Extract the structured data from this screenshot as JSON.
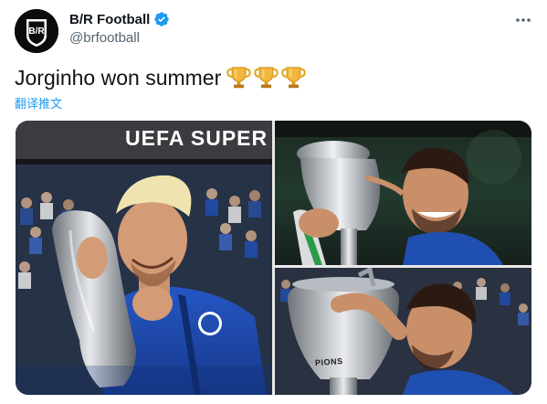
{
  "tweet": {
    "display_name": "B/R Football",
    "handle": "@brfootball",
    "text": "Jorginho won summer",
    "translate_label": "翻译推文",
    "avatar_logo_text": "B/R",
    "more_icon": "more-horizontal-icon",
    "verified_icon": "verified-badge-icon",
    "trophy_count": 3
  },
  "media": {
    "photo_1": {
      "banner_text": "UEFA SUPER C"
    },
    "photo_2": {},
    "photo_3": {
      "trophy_engraving": "PIONS"
    }
  },
  "colors": {
    "link_blue": "#1d9bf0",
    "verified_blue": "#1d9bf0",
    "text_primary": "#0f1419",
    "text_secondary": "#536471",
    "chelsea_blue": "#1f4fb0",
    "trophy_gold": "#e0a81f"
  }
}
